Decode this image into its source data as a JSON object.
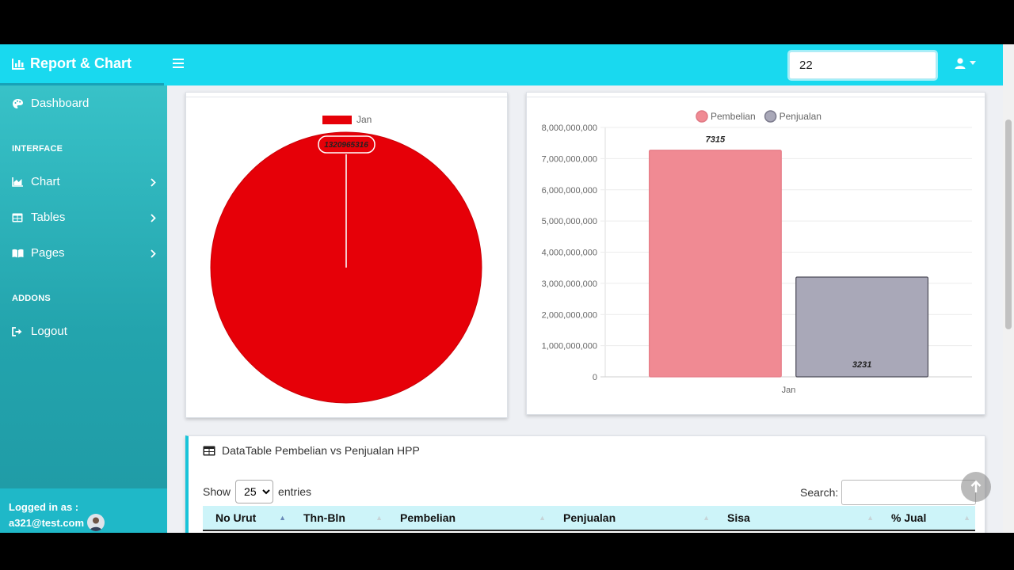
{
  "navbar": {
    "brand": "Report & Chart",
    "search_value": "22"
  },
  "sidebar": {
    "dashboard": "Dashboard",
    "heading_interface": "INTERFACE",
    "chart": "Chart",
    "tables": "Tables",
    "pages": "Pages",
    "heading_addons": "ADDONS",
    "logout": "Logout",
    "logged_label": "Logged in as :",
    "logged_email": "a321@test.com"
  },
  "pie": {
    "legend": "Jan",
    "value_label": "1320965316",
    "color": "#e60008"
  },
  "chart_data": {
    "type": "bar",
    "categories": [
      "Jan"
    ],
    "series": [
      {
        "name": "Pembelian",
        "values": [
          7315
        ],
        "color": "#f08a93"
      },
      {
        "name": "Penjualan",
        "values": [
          3231
        ],
        "color": "#a9a8b8"
      }
    ],
    "y_axis_ticks": [
      0,
      1000000000,
      2000000000,
      3000000000,
      4000000000,
      5000000000,
      6000000000,
      7000000000,
      8000000000
    ],
    "y_axis_tick_labels": [
      "0",
      "1,000,000,000",
      "2,000,000,000",
      "3,000,000,000",
      "4,000,000,000",
      "5,000,000,000",
      "6,000,000,000",
      "7,000,000,000",
      "8,000,000,000"
    ],
    "bar_heights_in_axis_units": [
      7270000000,
      3200000000
    ],
    "ylim": [
      0,
      8000000000
    ],
    "legend_position": "top",
    "grid": true
  },
  "table": {
    "title": "DataTable Pembelian vs Penjualan HPP",
    "show_label": "Show",
    "entries_label": "entries",
    "length_value": "25",
    "search_label": "Search:",
    "columns": [
      "No Urut",
      "Thn-Bln",
      "Pembelian",
      "Penjualan",
      "Sisa",
      "% Jual"
    ]
  }
}
